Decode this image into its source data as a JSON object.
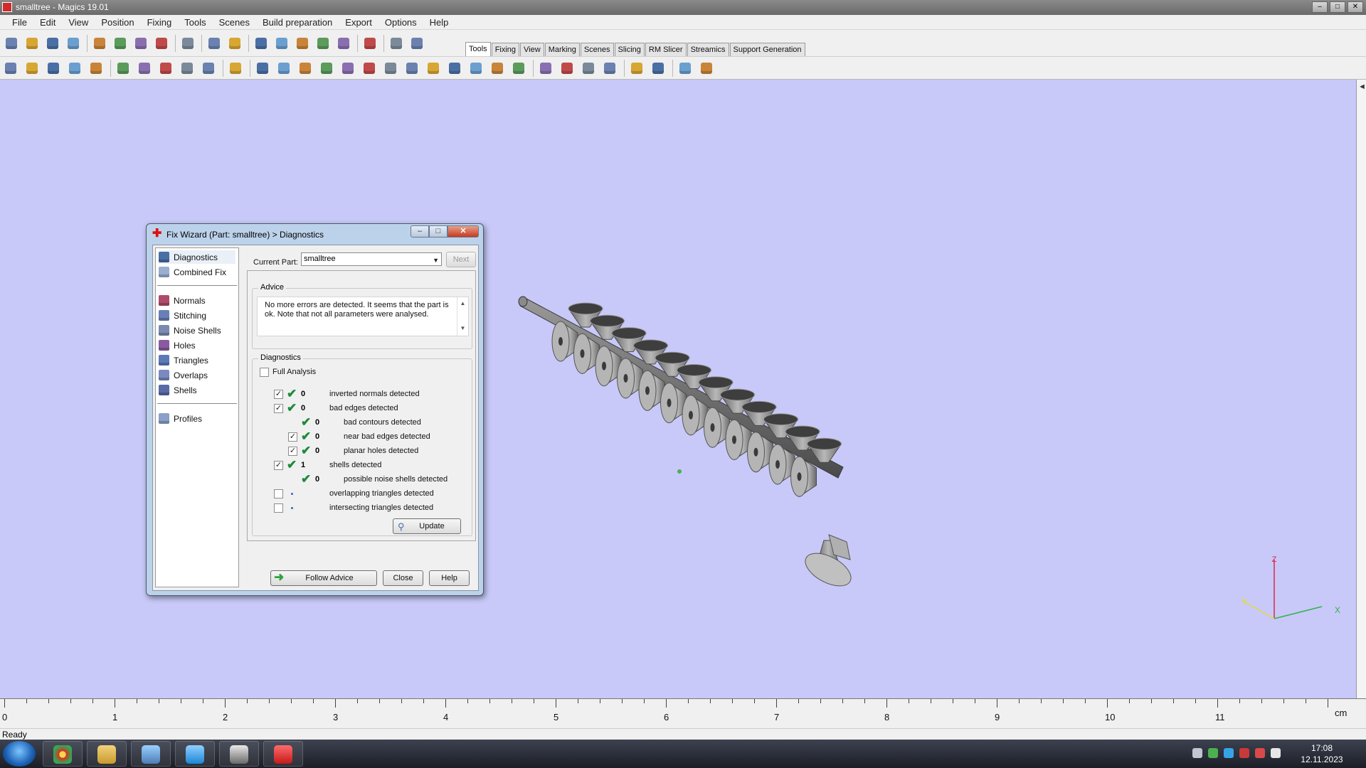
{
  "window": {
    "title": "smalltree - Magics 19.01",
    "buttons": [
      "–",
      "□",
      "✕"
    ]
  },
  "menu": [
    "File",
    "Edit",
    "View",
    "Position",
    "Fixing",
    "Tools",
    "Scenes",
    "Build preparation",
    "Export",
    "Options",
    "Help"
  ],
  "tabs": [
    "Tools",
    "Fixing",
    "View",
    "Marking",
    "Scenes",
    "Slicing",
    "RM Slicer",
    "Streamics",
    "Support Generation"
  ],
  "active_tab": "Tools",
  "toolbar_icons": {
    "row1": [
      "new-file-icon",
      "open-icon",
      "save-icon",
      "save-as-icon",
      "import-icon",
      "save-part-icon",
      "load-icon",
      "unload-icon",
      "print-icon",
      "undo-icon",
      "redo-icon",
      "select-icon",
      "rotate-icon",
      "translate-icon",
      "zoom-icon",
      "zoom-fit-icon",
      "checklist-icon",
      "help-icon",
      "wizard-icon"
    ],
    "row2": [
      "pan-icon",
      "move-icon",
      "rotate-view-icon",
      "rotate-free-icon",
      "copy-icon",
      "mirror-icon",
      "box-icon",
      "cut-icon",
      "measure-icon",
      "layer-icon",
      "hand-icon",
      "select-triangle-icon",
      "part-icon",
      "multi-part-icon",
      "brush-icon",
      "shell-icon",
      "overlap-icon",
      "front-view-icon",
      "back-view-icon",
      "iso-view-icon",
      "section-icon",
      "wireframe-icon",
      "shaded-icon",
      "outline-icon",
      "align-icon",
      "lock-icon",
      "scale-icon",
      "render-icon",
      "support-icon",
      "settings-icon",
      "slice-icon",
      "export-icon"
    ]
  },
  "side_strip": {
    "label": "◄"
  },
  "ruler": {
    "labels": [
      "0",
      "1",
      "2",
      "3",
      "4",
      "5",
      "6",
      "7",
      "8",
      "9",
      "10",
      "11"
    ],
    "unit": "cm"
  },
  "status": {
    "text": "Ready"
  },
  "taskbar": {
    "time": "17:08",
    "date": "12.11.2023"
  },
  "dialog": {
    "title": "Fix Wizard (Part: smalltree) > Diagnostics",
    "nav_top": [
      {
        "label": "Diagnostics",
        "icon": "magnifier-icon"
      },
      {
        "label": "Combined Fix",
        "icon": "combined-fix-icon"
      }
    ],
    "nav_mid": [
      {
        "label": "Normals",
        "icon": "normals-icon"
      },
      {
        "label": "Stitching",
        "icon": "stitching-icon"
      },
      {
        "label": "Noise Shells",
        "icon": "noise-shells-icon"
      },
      {
        "label": "Holes",
        "icon": "holes-icon"
      },
      {
        "label": "Triangles",
        "icon": "triangles-icon"
      },
      {
        "label": "Overlaps",
        "icon": "overlaps-icon"
      },
      {
        "label": "Shells",
        "icon": "shells-icon"
      }
    ],
    "nav_bottom": [
      {
        "label": "Profiles",
        "icon": "profiles-icon"
      }
    ],
    "current_part_label": "Current Part:",
    "current_part_value": "smalltree",
    "next_label": "Next",
    "advice_title": "Advice",
    "advice_text": "No more errors are detected. It seems that the part is ok. Note that not all parameters were analysed.",
    "diagnostics_title": "Diagnostics",
    "full_analysis_label": "Full Analysis",
    "full_analysis_checked": false,
    "rows": [
      {
        "checked": true,
        "has_checkbox": true,
        "status": "ok",
        "value": "0",
        "label": "inverted normals detected",
        "indent": 0
      },
      {
        "checked": true,
        "has_checkbox": true,
        "status": "ok",
        "value": "0",
        "label": "bad edges detected",
        "indent": 0
      },
      {
        "checked": false,
        "has_checkbox": false,
        "status": "ok",
        "value": "0",
        "label": "bad contours detected",
        "indent": 1
      },
      {
        "checked": true,
        "has_checkbox": true,
        "status": "ok",
        "value": "0",
        "label": "near bad edges detected",
        "indent": 1
      },
      {
        "checked": true,
        "has_checkbox": true,
        "status": "ok",
        "value": "0",
        "label": "planar holes detected",
        "indent": 1
      },
      {
        "checked": true,
        "has_checkbox": true,
        "status": "ok",
        "value": "1",
        "label": "shells detected",
        "indent": 0
      },
      {
        "checked": false,
        "has_checkbox": false,
        "status": "ok",
        "value": "0",
        "label": "possible noise shells detected",
        "indent": 1
      },
      {
        "checked": false,
        "has_checkbox": true,
        "status": "pending",
        "value": "",
        "label": "overlapping triangles detected",
        "indent": 0
      },
      {
        "checked": false,
        "has_checkbox": true,
        "status": "pending",
        "value": "",
        "label": "intersecting triangles detected",
        "indent": 0
      }
    ],
    "update_label": "Update",
    "follow_advice_label": "Follow Advice",
    "close_label": "Close",
    "help_label": "Help"
  },
  "axes": {
    "z": "Z",
    "x": "X",
    "y": "Y"
  },
  "colors": {
    "viewport": "#c8c9f8",
    "model": "#8a8a8a",
    "ok_check": "#1f8a3a"
  }
}
